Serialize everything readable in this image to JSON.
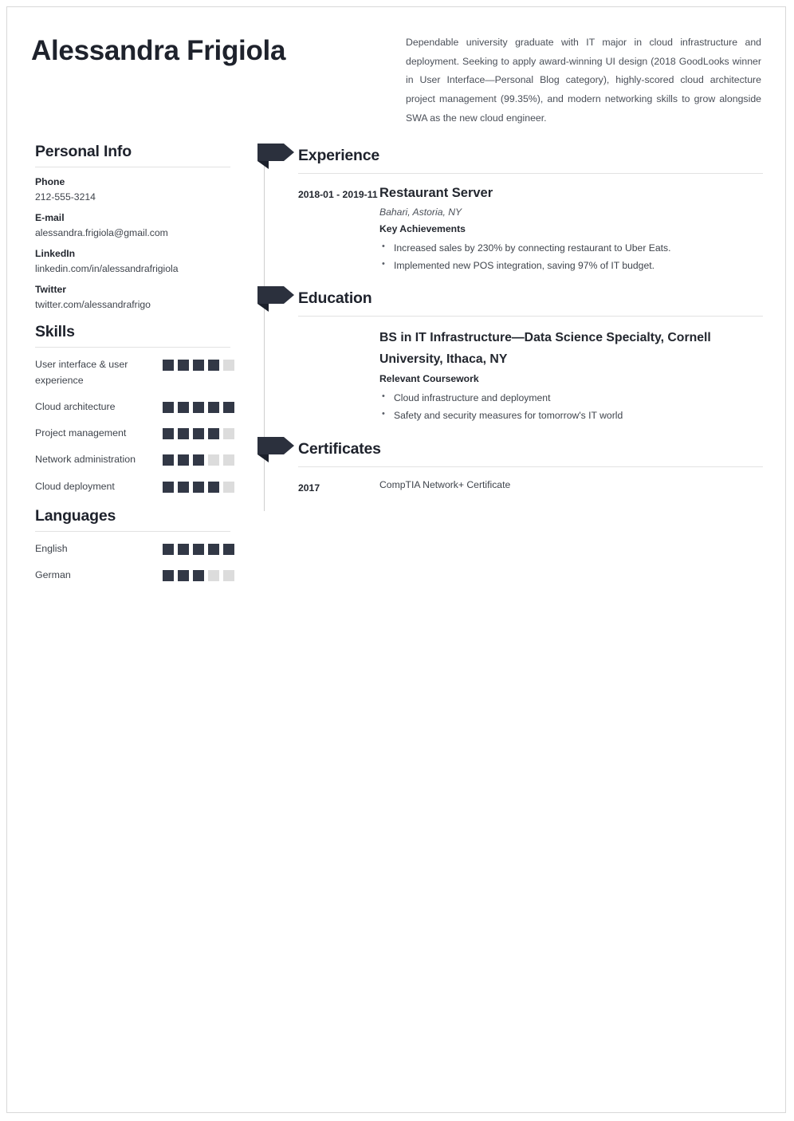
{
  "colors": {
    "ink": "#1e222c",
    "accent": "#2b303d",
    "rule": "#e2e2e2",
    "filled_square": "#323846",
    "empty_square": "#dcdcdc"
  },
  "header": {
    "name": "Alessandra Frigiola",
    "summary": "Dependable university graduate with IT major in cloud infrastructure and deployment. Seeking to apply award-winning UI design (2018 GoodLooks winner in User Interface—Personal Blog category), highly-scored cloud architecture project management (99.35%), and modern networking skills to grow alongside SWA as the new cloud engineer."
  },
  "sidebar": {
    "personal_info": {
      "title": "Personal Info",
      "items": [
        {
          "label": "Phone",
          "value": "212-555-3214"
        },
        {
          "label": "E-mail",
          "value": "alessandra.frigiola@gmail.com"
        },
        {
          "label": "LinkedIn",
          "value": "linkedin.com/in/alessandrafrigiola"
        },
        {
          "label": "Twitter",
          "value": "twitter.com/alessandrafrigo"
        }
      ]
    },
    "skills": {
      "title": "Skills",
      "max": 5,
      "items": [
        {
          "label": "User interface & user experience",
          "level": 4
        },
        {
          "label": "Cloud architecture",
          "level": 5
        },
        {
          "label": "Project management",
          "level": 4
        },
        {
          "label": "Network administration",
          "level": 3
        },
        {
          "label": "Cloud deployment",
          "level": 4
        }
      ]
    },
    "languages": {
      "title": "Languages",
      "max": 5,
      "items": [
        {
          "label": "English",
          "level": 5
        },
        {
          "label": "German",
          "level": 3
        }
      ]
    }
  },
  "main": {
    "experience": {
      "title": "Experience",
      "entries": [
        {
          "date": "2018-01 - 2019-11",
          "title": "Restaurant Server",
          "subtitle": "Bahari, Astoria, NY",
          "subhead": "Key Achievements",
          "bullets": [
            "Increased sales by 230% by connecting restaurant to Uber Eats.",
            "Implemented new POS integration, saving 97% of IT budget."
          ]
        }
      ]
    },
    "education": {
      "title": "Education",
      "entries": [
        {
          "date": "",
          "title": "BS in IT Infrastructure—Data Science Specialty, Cornell University, Ithaca, NY",
          "subhead": "Relevant Coursework",
          "bullets": [
            "Cloud infrastructure and deployment",
            "Safety and security measures for tomorrow's IT world"
          ]
        }
      ]
    },
    "certificates": {
      "title": "Certificates",
      "entries": [
        {
          "date": "2017",
          "name": "CompTIA Network+ Certificate"
        }
      ]
    }
  }
}
